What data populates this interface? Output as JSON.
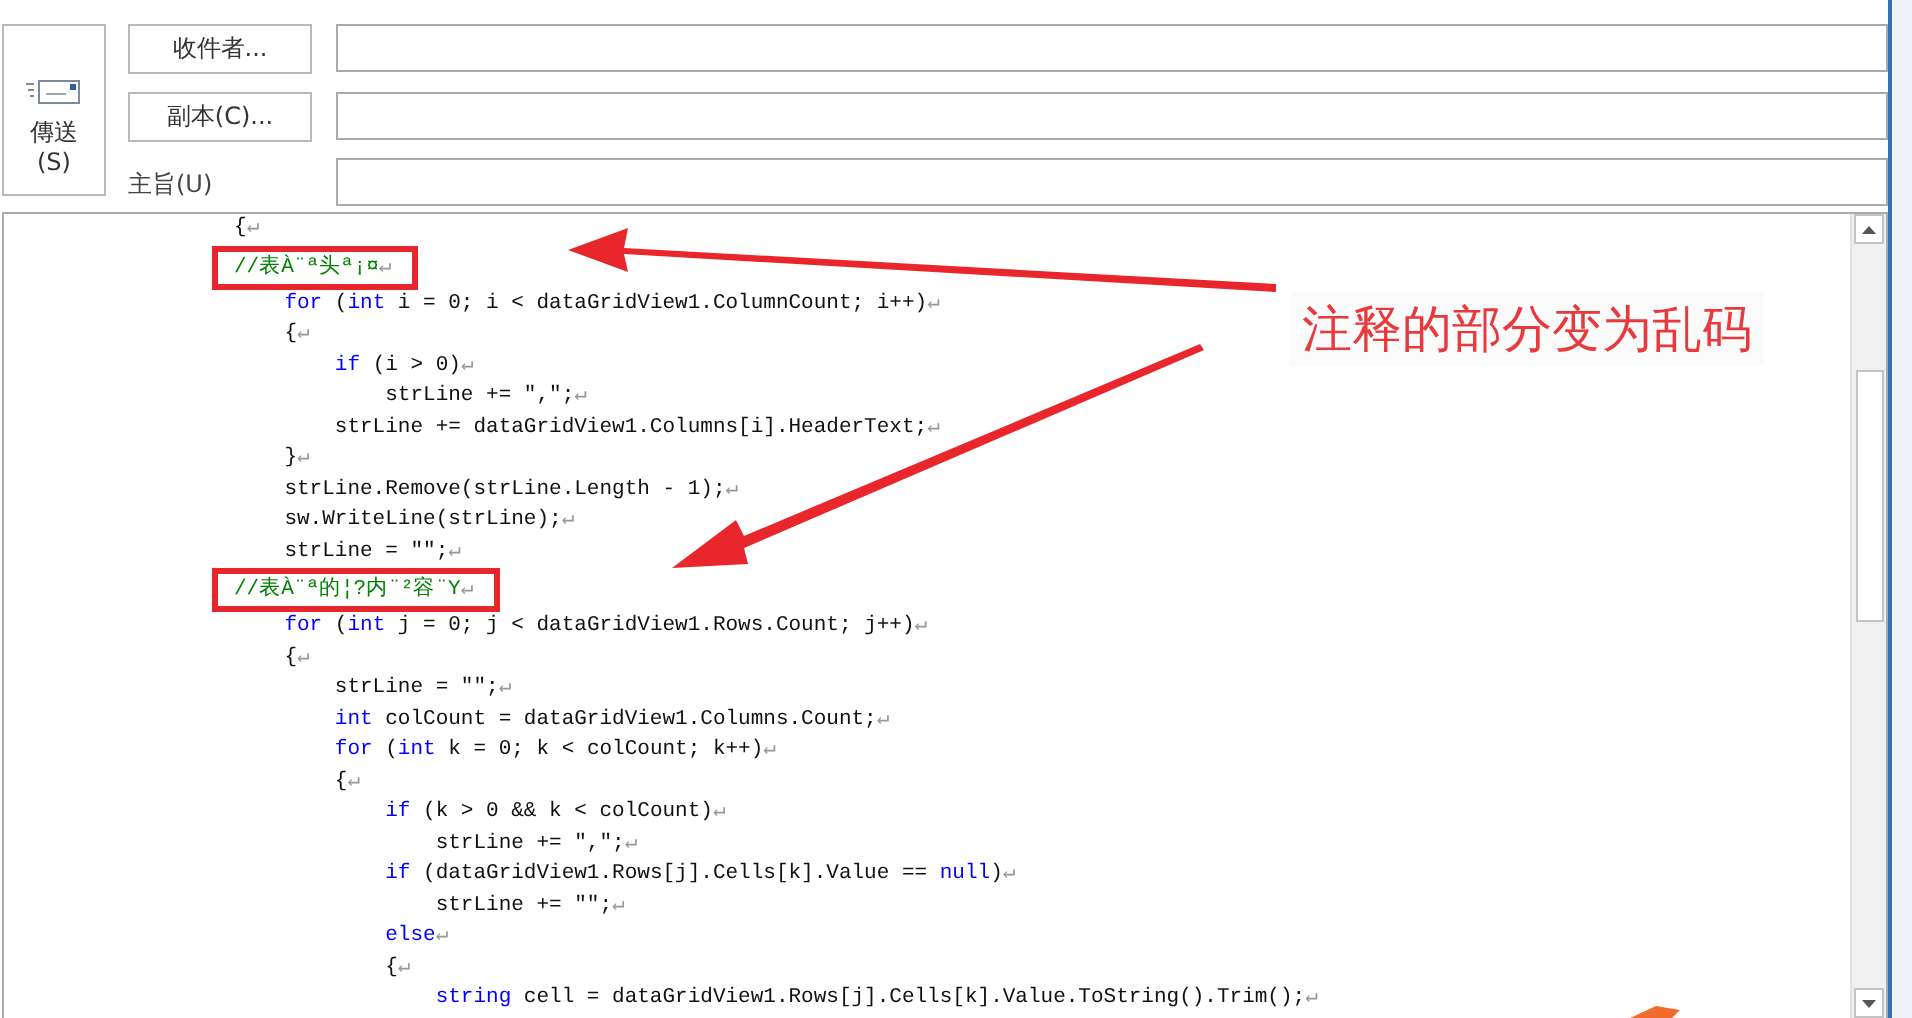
{
  "header": {
    "send_button": {
      "label": "傳送",
      "shortcut": "(S)"
    },
    "address_buttons": [
      "收件者...",
      "副本(C)..."
    ],
    "subject_label": "主旨(U)"
  },
  "body": {
    "lines": [
      {
        "annotated": false,
        "segments": [
          {
            "kind": "plain",
            "text": "{"
          },
          {
            "kind": "mark",
            "text": "↵"
          }
        ]
      },
      {
        "annotated": true,
        "segments": [
          {
            "kind": "comment",
            "text": "//表À¨ª头ª¡¤"
          },
          {
            "kind": "mark",
            "text": "↵"
          }
        ]
      },
      {
        "annotated": false,
        "segments": [
          {
            "kind": "keyword",
            "text": "    for"
          },
          {
            "kind": "plain",
            "text": " ("
          },
          {
            "kind": "keyword",
            "text": "int"
          },
          {
            "kind": "plain",
            "text": " i = 0; i < dataGridView1.ColumnCount; i++)"
          },
          {
            "kind": "mark",
            "text": "↵"
          }
        ]
      },
      {
        "annotated": false,
        "segments": [
          {
            "kind": "plain",
            "text": "    {"
          },
          {
            "kind": "mark",
            "text": "↵"
          }
        ]
      },
      {
        "annotated": false,
        "segments": [
          {
            "kind": "keyword",
            "text": "        if"
          },
          {
            "kind": "plain",
            "text": " (i > 0)"
          },
          {
            "kind": "mark",
            "text": "↵"
          }
        ]
      },
      {
        "annotated": false,
        "segments": [
          {
            "kind": "plain",
            "text": "            strLine += \",\";"
          },
          {
            "kind": "mark",
            "text": "↵"
          }
        ]
      },
      {
        "annotated": false,
        "segments": [
          {
            "kind": "plain",
            "text": "        strLine += dataGridView1.Columns[i].HeaderText;"
          },
          {
            "kind": "mark",
            "text": "↵"
          }
        ]
      },
      {
        "annotated": false,
        "segments": [
          {
            "kind": "plain",
            "text": "    }"
          },
          {
            "kind": "mark",
            "text": "↵"
          }
        ]
      },
      {
        "annotated": false,
        "segments": [
          {
            "kind": "plain",
            "text": "    strLine.Remove(strLine.Length - 1);"
          },
          {
            "kind": "mark",
            "text": "↵"
          }
        ]
      },
      {
        "annotated": false,
        "segments": [
          {
            "kind": "plain",
            "text": "    sw.WriteLine(strLine);"
          },
          {
            "kind": "mark",
            "text": "↵"
          }
        ]
      },
      {
        "annotated": false,
        "segments": [
          {
            "kind": "plain",
            "text": "    strLine = \"\";"
          },
          {
            "kind": "mark",
            "text": "↵"
          }
        ]
      },
      {
        "annotated": true,
        "segments": [
          {
            "kind": "comment",
            "text": "//表À¨ª的¦?内¨²容¨Y"
          },
          {
            "kind": "mark",
            "text": "↵"
          }
        ]
      },
      {
        "annotated": false,
        "segments": [
          {
            "kind": "keyword",
            "text": "    for"
          },
          {
            "kind": "plain",
            "text": " ("
          },
          {
            "kind": "keyword",
            "text": "int"
          },
          {
            "kind": "plain",
            "text": " j = 0; j < dataGridView1.Rows.Count; j++)"
          },
          {
            "kind": "mark",
            "text": "↵"
          }
        ]
      },
      {
        "annotated": false,
        "segments": [
          {
            "kind": "plain",
            "text": "    {"
          },
          {
            "kind": "mark",
            "text": "↵"
          }
        ]
      },
      {
        "annotated": false,
        "segments": [
          {
            "kind": "plain",
            "text": "        strLine = \"\";"
          },
          {
            "kind": "mark",
            "text": "↵"
          }
        ]
      },
      {
        "annotated": false,
        "segments": [
          {
            "kind": "keyword",
            "text": "        int"
          },
          {
            "kind": "plain",
            "text": " colCount = dataGridView1.Columns.Count;"
          },
          {
            "kind": "mark",
            "text": "↵"
          }
        ]
      },
      {
        "annotated": false,
        "segments": [
          {
            "kind": "keyword",
            "text": "        for"
          },
          {
            "kind": "plain",
            "text": " ("
          },
          {
            "kind": "keyword",
            "text": "int"
          },
          {
            "kind": "plain",
            "text": " k = 0; k < colCount; k++)"
          },
          {
            "kind": "mark",
            "text": "↵"
          }
        ]
      },
      {
        "annotated": false,
        "segments": [
          {
            "kind": "plain",
            "text": "        {"
          },
          {
            "kind": "mark",
            "text": "↵"
          }
        ]
      },
      {
        "annotated": false,
        "segments": [
          {
            "kind": "keyword",
            "text": "            if"
          },
          {
            "kind": "plain",
            "text": " (k > 0 && k < colCount)"
          },
          {
            "kind": "mark",
            "text": "↵"
          }
        ]
      },
      {
        "annotated": false,
        "segments": [
          {
            "kind": "plain",
            "text": "                strLine += \",\";"
          },
          {
            "kind": "mark",
            "text": "↵"
          }
        ]
      },
      {
        "annotated": false,
        "segments": [
          {
            "kind": "keyword",
            "text": "            if"
          },
          {
            "kind": "plain",
            "text": " (dataGridView1.Rows[j].Cells[k].Value == "
          },
          {
            "kind": "keyword",
            "text": "null"
          },
          {
            "kind": "plain",
            "text": ")"
          },
          {
            "kind": "mark",
            "text": "↵"
          }
        ]
      },
      {
        "annotated": false,
        "segments": [
          {
            "kind": "plain",
            "text": "                strLine += \"\";"
          },
          {
            "kind": "mark",
            "text": "↵"
          }
        ]
      },
      {
        "annotated": false,
        "segments": [
          {
            "kind": "keyword",
            "text": "            else"
          },
          {
            "kind": "mark",
            "text": "↵"
          }
        ]
      },
      {
        "annotated": false,
        "segments": [
          {
            "kind": "plain",
            "text": "            {"
          },
          {
            "kind": "mark",
            "text": "↵"
          }
        ]
      },
      {
        "annotated": false,
        "segments": [
          {
            "kind": "keyword",
            "text": "                string"
          },
          {
            "kind": "plain",
            "text": " cell = dataGridView1.Rows[j].Cells[k].Value.ToString().Trim();"
          },
          {
            "kind": "mark",
            "text": "↵"
          }
        ]
      }
    ]
  },
  "annotation": {
    "note": "注释的部分变为乱码"
  }
}
